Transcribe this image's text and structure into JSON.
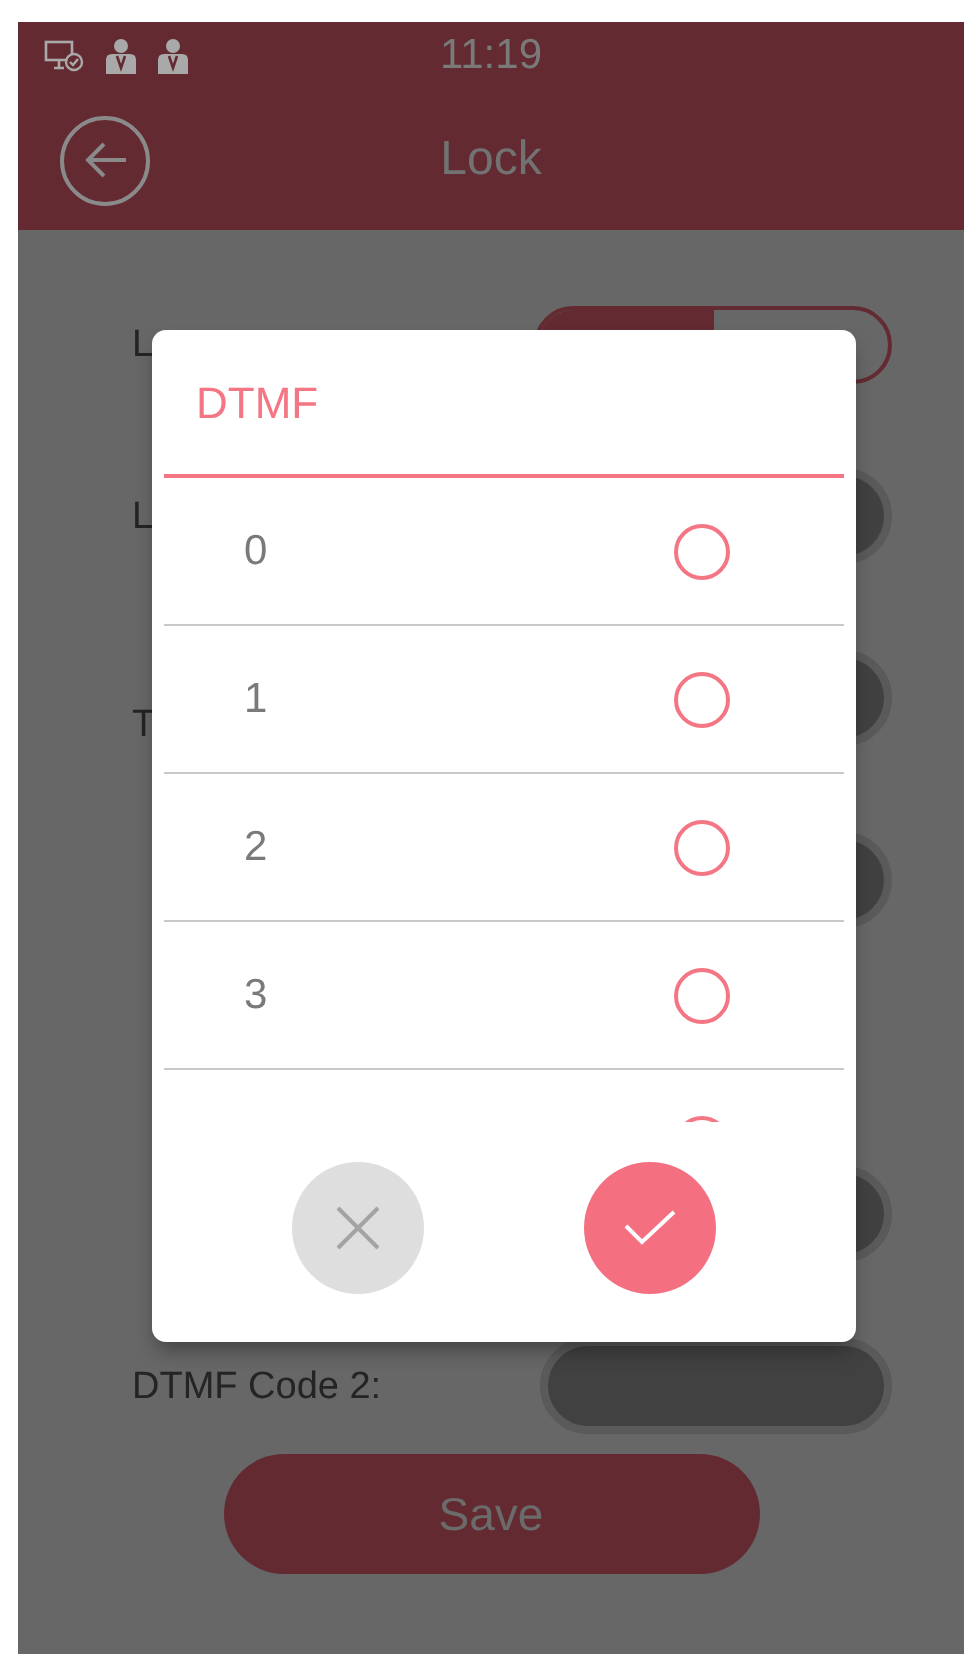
{
  "status_bar": {
    "time": "11:19"
  },
  "header": {
    "title": "Lock"
  },
  "form": {
    "rows": [
      {
        "kind": "toggle",
        "label_lines": [
          "L"
        ],
        "segments": [
          {
            "selected": true
          },
          {
            "selected": false
          }
        ]
      },
      {
        "kind": "field",
        "label_lines": [
          "L"
        ]
      },
      {
        "kind": "field",
        "label_lines": [
          "T"
        ]
      },
      {
        "kind": "field"
      },
      {
        "kind": "covered"
      },
      {
        "kind": "field"
      },
      {
        "kind": "field",
        "label_lines": [
          "DTMF Code 2:"
        ]
      }
    ],
    "save_button": "Save"
  },
  "dialog": {
    "title": "DTMF",
    "options": [
      {
        "label": "0",
        "selected": false
      },
      {
        "label": "1",
        "selected": false
      },
      {
        "label": "2",
        "selected": false
      },
      {
        "label": "3",
        "selected": false
      }
    ],
    "partial_option": {
      "selected": false
    }
  }
}
